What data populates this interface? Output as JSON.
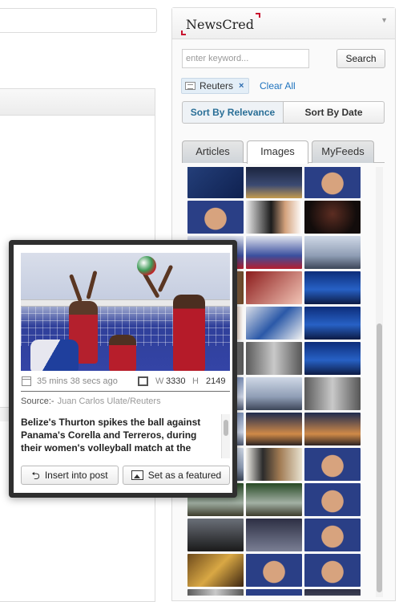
{
  "newscred": {
    "logo": "NewsCred",
    "collapse_icon": "triangle-down-icon",
    "search": {
      "placeholder": "enter keyword...",
      "value": "",
      "button_label": "Search"
    },
    "filter": {
      "tag_label": "Reuters",
      "remove_symbol": "×",
      "clear_label": "Clear All"
    },
    "sort": {
      "relevance_label": "Sort By Relevance",
      "date_label": "Sort By Date",
      "active": "relevance"
    },
    "tabs": [
      {
        "label": "Articles",
        "active": false
      },
      {
        "label": "Images",
        "active": true
      },
      {
        "label": "MyFeeds",
        "active": false
      }
    ],
    "thumbnails": [
      "p-blue",
      "p-night",
      "p-face",
      "p-face",
      "p-meet",
      "p-dark",
      "p-court",
      "p-court",
      "p-rome",
      "p-room",
      "p-red",
      "p-soc",
      "p-meet",
      "p-flag",
      "p-soc",
      "p-off",
      "p-off",
      "p-soc",
      "p-sky",
      "p-rome",
      "p-off",
      "p-sky",
      "p-sun",
      "p-sun",
      "p-rome",
      "p-cere",
      "p-face",
      "p-green",
      "p-green",
      "p-face",
      "p-tv",
      "p-crowd",
      "p-face",
      "p-gold",
      "p-face",
      "p-face",
      "p-off",
      "p-face",
      "p-crowd"
    ]
  },
  "preview": {
    "time_ago": "35 mins 38 secs ago",
    "width_label": "W",
    "width": "3330",
    "height_label": "H",
    "height": "2149",
    "source_label": "Source:-",
    "source": "Juan Carlos Ulate/Reuters",
    "caption": "Belize's Thurton spikes the ball against Panama's Corella and Terreros, during their women's volleyball match at the",
    "insert_label": "Insert into post",
    "featured_label": "Set as a featured"
  },
  "colors": {
    "accent_red": "#c8102e",
    "link_blue": "#1e73be",
    "active_sort_text": "#2a6f97"
  }
}
